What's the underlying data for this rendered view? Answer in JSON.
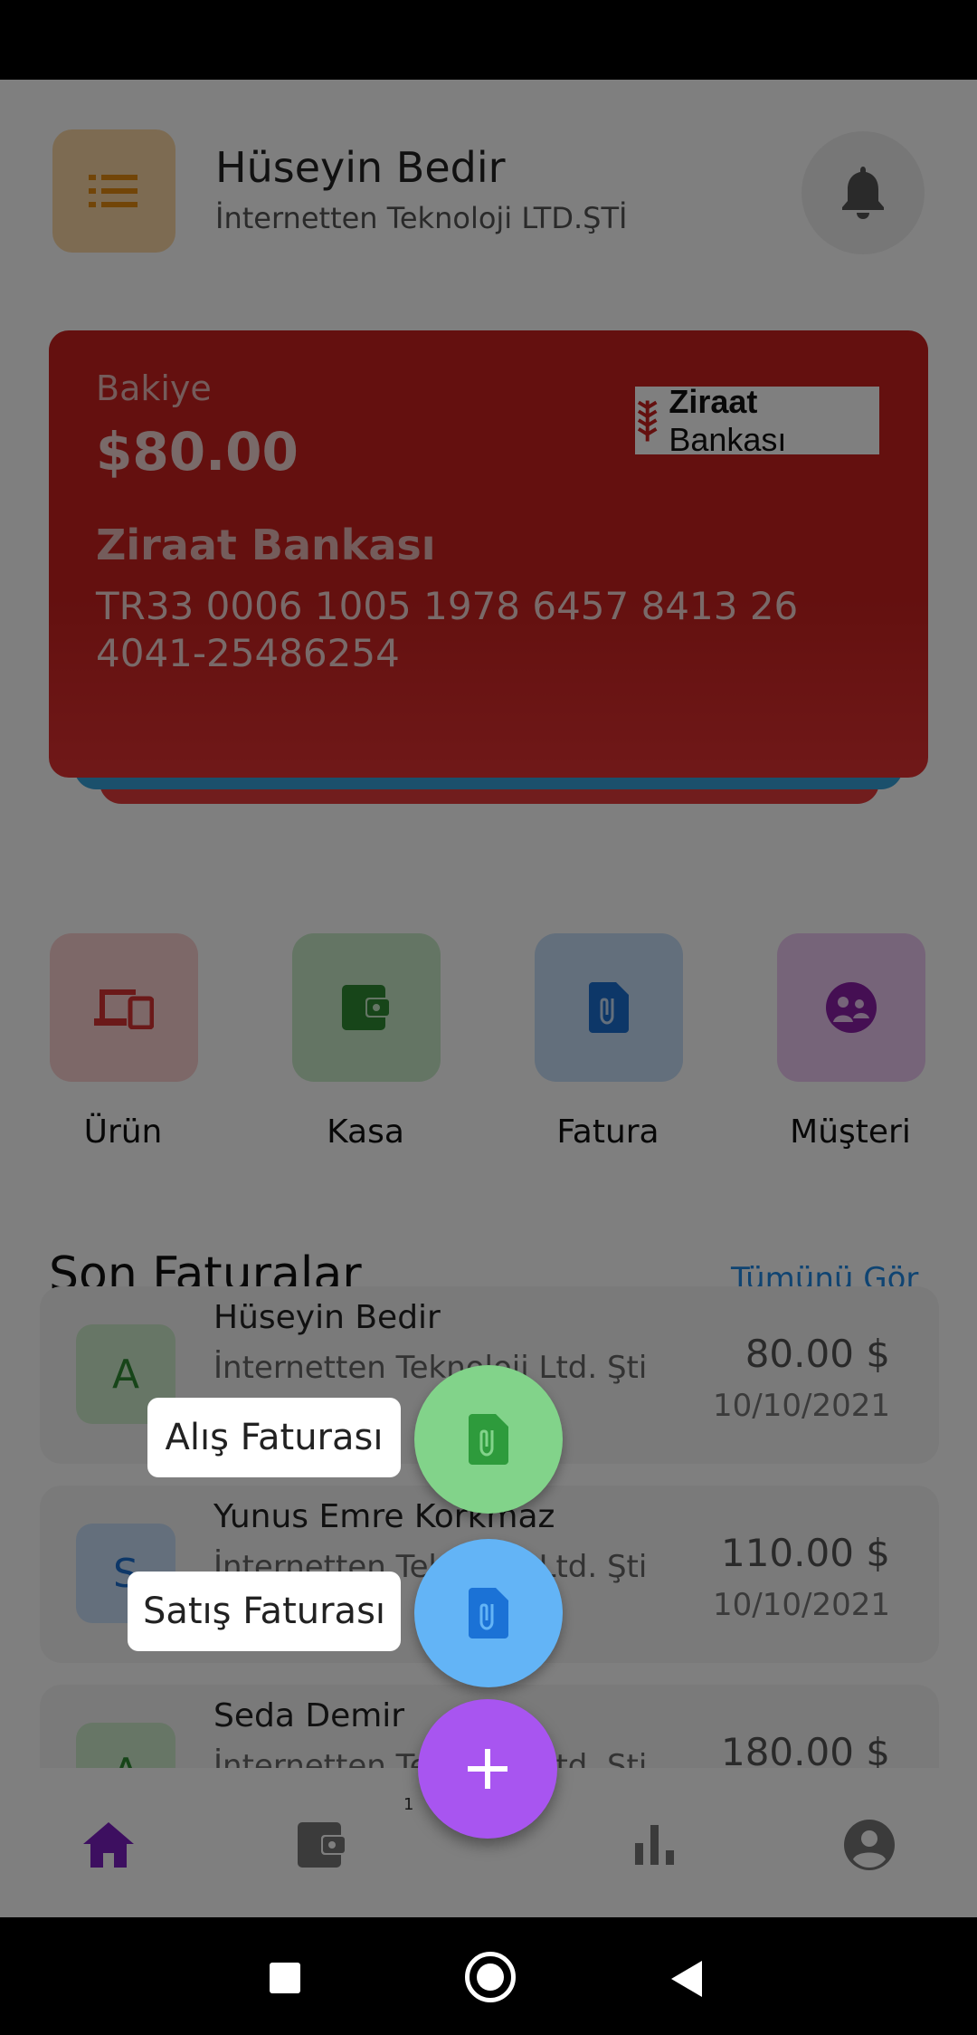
{
  "header": {
    "name": "Hüseyin Bedir",
    "company": "İnternetten Teknoloji LTD.ŞTİ"
  },
  "card": {
    "balance_label": "Bakiye",
    "balance": "$80.00",
    "bank_name": "Ziraat Bankası",
    "iban": "TR33 0006 1005 1978 6457 8413 26",
    "account_no": "4041-25486254",
    "logo_text_bold": "Ziraat",
    "logo_text": "Bankası"
  },
  "quick_actions": [
    {
      "label": "Ürün",
      "icon": "devices-icon"
    },
    {
      "label": "Kasa",
      "icon": "wallet-icon"
    },
    {
      "label": "Fatura",
      "icon": "invoice-icon"
    },
    {
      "label": "Müşteri",
      "icon": "customers-icon"
    }
  ],
  "recent": {
    "title": "Son Faturalar",
    "see_all": "Tümünü Gör",
    "items": [
      {
        "avatar": "A",
        "name": "Hüseyin Bedir",
        "company": "İnternetten Teknoloji Ltd. Şti",
        "amount": "80.00 $",
        "date": "10/10/2021"
      },
      {
        "avatar": "S",
        "name": "Yunus Emre Korkmaz",
        "company": "İnternetten Teknoloji Ltd. Şti",
        "amount": "110.00 $",
        "date": "10/10/2021"
      },
      {
        "avatar": "A",
        "name": "Seda Demir",
        "company": "İnternetten Teknoloji Ltd. Şti",
        "amount": "180.00 $",
        "date": ""
      }
    ]
  },
  "fab": {
    "purchase_label": "Alış Faturası",
    "sales_label": "Satış Faturası",
    "main_symbol": "+"
  },
  "bottom_nav": {
    "center_badge": "1",
    "items": [
      "home-icon",
      "wallet-icon",
      "chart-icon",
      "account-icon"
    ]
  },
  "colors": {
    "accent_purple": "#a855f0",
    "bank_red": "#c8211f",
    "green_fab": "#82d38a",
    "blue_fab": "#63b4f6",
    "link_blue": "#1e88e5"
  }
}
